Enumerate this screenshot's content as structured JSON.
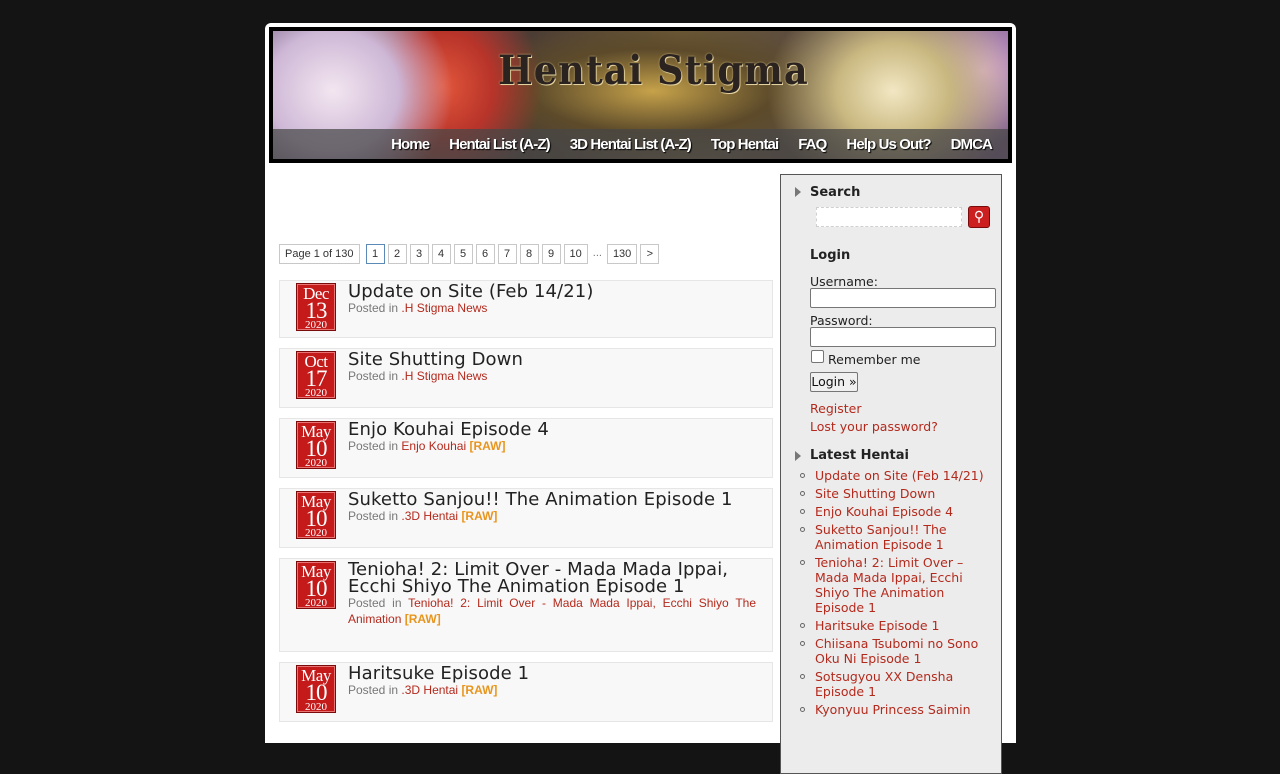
{
  "site": {
    "logo_text": "Hentai Stigma",
    "nav": [
      "Home",
      "Hentai List (A-Z)",
      "3D Hentai List (A-Z)",
      "Top Hentai",
      "FAQ",
      "Help Us Out?",
      "DMCA"
    ]
  },
  "pagination": {
    "info": "Page 1 of 130",
    "pages": [
      "1",
      "2",
      "3",
      "4",
      "5",
      "6",
      "7",
      "8",
      "9",
      "10"
    ],
    "current": "1",
    "ellipsis": "...",
    "last": "130",
    "next": ">"
  },
  "posts": [
    {
      "month": "Dec",
      "day": "13",
      "year": "2020",
      "title": "Update on Site (Feb 14/21)",
      "posted_in": "Posted in",
      "category": ".H Stigma News",
      "tag": ""
    },
    {
      "month": "Oct",
      "day": "17",
      "year": "2020",
      "title": "Site Shutting Down",
      "posted_in": "Posted in",
      "category": ".H Stigma News",
      "tag": ""
    },
    {
      "month": "May",
      "day": "10",
      "year": "2020",
      "title": "Enjo Kouhai Episode 4",
      "posted_in": "Posted in",
      "category": "Enjo Kouhai",
      "tag": "[RAW]"
    },
    {
      "month": "May",
      "day": "10",
      "year": "2020",
      "title": "Suketto Sanjou!! The Animation Episode 1",
      "posted_in": "Posted in",
      "category": ".3D Hentai",
      "tag": "[RAW]"
    },
    {
      "month": "May",
      "day": "10",
      "year": "2020",
      "title": "Tenioha! 2: Limit Over - Mada Mada Ippai, Ecchi Shiyo The Animation Episode 1",
      "posted_in": "Posted in",
      "category": "Tenioha! 2: Limit Over - Mada Mada Ippai, Ecchi Shiyo The Animation",
      "tag": "[RAW]"
    },
    {
      "month": "May",
      "day": "10",
      "year": "2020",
      "title": "Haritsuke Episode 1",
      "posted_in": "Posted in",
      "category": ".3D Hentai",
      "tag": "[RAW]"
    }
  ],
  "sidebar": {
    "search_heading": "Search",
    "login_heading": "Login",
    "username_label": "Username:",
    "password_label": "Password:",
    "remember_label": "Remember me",
    "login_button": "Login »",
    "register_link": "Register",
    "lost_password_link": "Lost your password?",
    "latest_heading": "Latest Hentai",
    "latest": [
      "Update on Site (Feb 14/21)",
      "Site Shutting Down",
      "Enjo Kouhai Episode 4",
      "Suketto Sanjou!! The Animation Episode 1",
      "Tenioha! 2: Limit Over – Mada Mada Ippai, Ecchi Shiyo The Animation Episode 1",
      "Haritsuke Episode 1",
      "Chiisana Tsubomi no Sono Oku Ni Episode 1",
      "Sotsugyou XX Densha Episode 1",
      "Kyonyuu Princess Saimin"
    ]
  },
  "colors": {
    "background": "#141414",
    "link": "#b32a1d",
    "raw_tag": "#e8951e",
    "date_box": "#c41a1a"
  }
}
